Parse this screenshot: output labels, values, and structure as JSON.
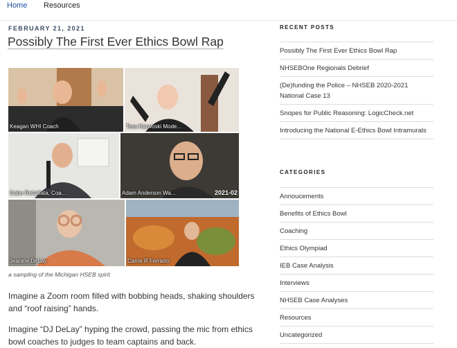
{
  "nav": {
    "home": "Home",
    "resources": "Resources"
  },
  "post": {
    "date": "FEBRUARY 21, 2021",
    "title": "Possibly The First Ever Ethics Bowl Rap",
    "image_caption": "a sampling of the Michigan HSEB spirit",
    "paragraphs": [
      "Imagine a Zoom room filled with bobbing heads, shaking shoulders and “roof raising” hands.",
      "Imagine “DJ DeLay” hyping the crowd, passing the mic from ethics bowl coaches to judges to team captains and back."
    ]
  },
  "zoom_tiles": [
    {
      "name": "Keagan WHI Coach"
    },
    {
      "name": "Tess Karwoski Mode..."
    },
    {
      "name": "Gabe Rettaliata, Coa..."
    },
    {
      "name": "Adam Anderson Wa...",
      "stamp": "2021-02"
    },
    {
      "name": "Jeanine DeLay"
    },
    {
      "name": "Carrie R Ferrario"
    }
  ],
  "sidebar": {
    "recent_heading": "RECENT POSTS",
    "recent_posts": [
      "Possibly The First Ever Ethics Bowl Rap",
      "NHSEBOne Regionals Debrief",
      "(De)funding the Police – NHSEB 2020-2021 National Case 13",
      "Snopes for Public Reasoning: LogicCheck.net",
      "Introducing the National E-Ethics Bowl Intramurals"
    ],
    "categories_heading": "CATEGORIES",
    "categories": [
      "Annoucements",
      "Benefits of Ethics Bowl",
      "Coaching",
      "Ethics Olympiad",
      "IEB Case Analysis",
      "Interviews",
      "NHSEB Case Analyses",
      "Resources",
      "Uncategorized"
    ]
  }
}
